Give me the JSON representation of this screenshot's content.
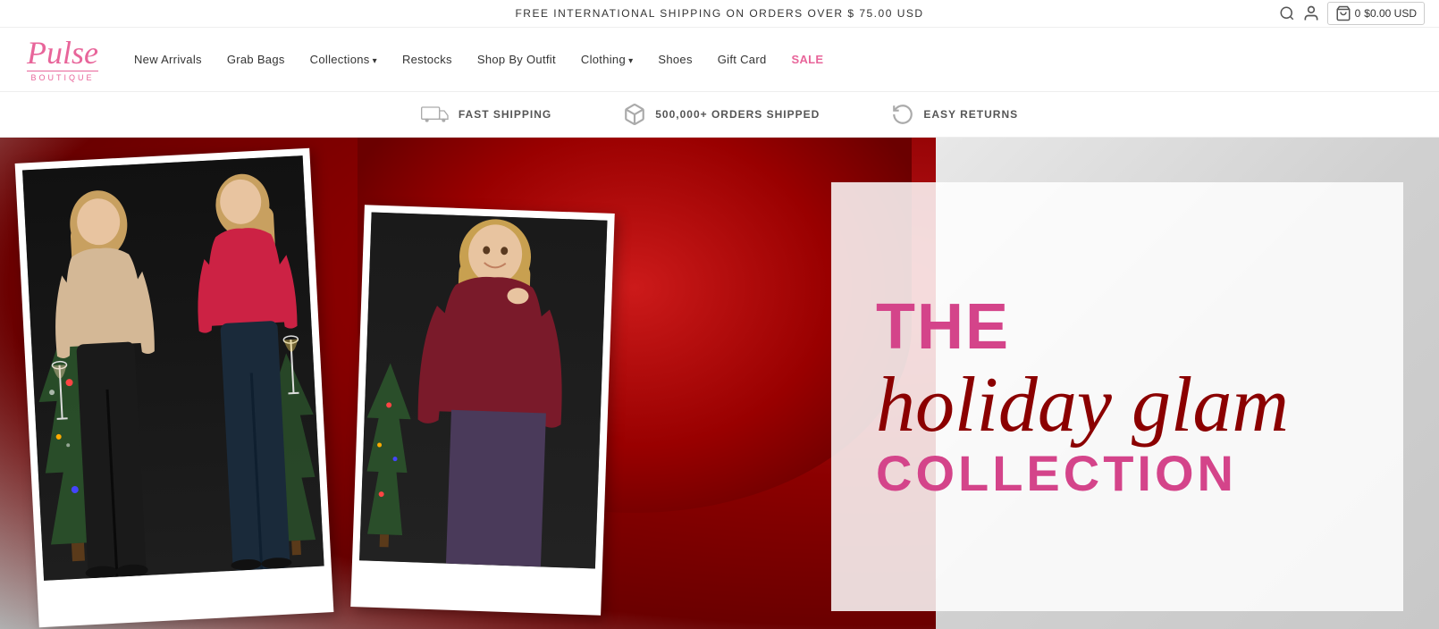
{
  "announcement": {
    "text": "FREE INTERNATIONAL SHIPPING ON ORDERS OVER $ 75.00 USD"
  },
  "nav": {
    "logo": {
      "brand": "Pulse",
      "sub": "BOUTIQUE"
    },
    "links": [
      {
        "label": "New Arrivals",
        "dropdown": false,
        "id": "new-arrivals"
      },
      {
        "label": "Grab Bags",
        "dropdown": false,
        "id": "grab-bags"
      },
      {
        "label": "Collections",
        "dropdown": true,
        "id": "collections"
      },
      {
        "label": "Restocks",
        "dropdown": false,
        "id": "restocks"
      },
      {
        "label": "Shop By Outfit",
        "dropdown": false,
        "id": "shop-outfit"
      },
      {
        "label": "Clothing",
        "dropdown": true,
        "id": "clothing"
      },
      {
        "label": "Shoes",
        "dropdown": false,
        "id": "shoes"
      },
      {
        "label": "Gift Card",
        "dropdown": false,
        "id": "gift-card"
      },
      {
        "label": "SALE",
        "dropdown": false,
        "id": "sale",
        "special": true
      }
    ]
  },
  "features": [
    {
      "icon": "truck",
      "label": "FAST SHIPPING"
    },
    {
      "icon": "box",
      "label": "500,000+ ORDERS SHIPPED"
    },
    {
      "icon": "return",
      "label": "EASY RETURNS"
    }
  ],
  "hero": {
    "line1": "THE",
    "line2": "holiday glam",
    "line3": "COLLECTION"
  },
  "cart": {
    "count": "0",
    "amount": "$0.00 USD"
  }
}
